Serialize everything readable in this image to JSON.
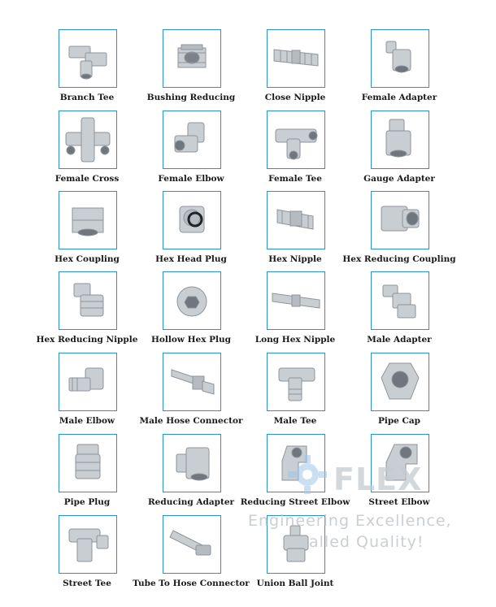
{
  "items": [
    {
      "label": "Branch Tee",
      "icon": "branch-tee-fitting"
    },
    {
      "label": "Bushing Reducing",
      "icon": "bushing-reducing-fitting"
    },
    {
      "label": "Close Nipple",
      "icon": "close-nipple-fitting"
    },
    {
      "label": "Female Adapter",
      "icon": "female-adapter-fitting"
    },
    {
      "label": "Female Cross",
      "icon": "female-cross-fitting"
    },
    {
      "label": "Female Elbow",
      "icon": "female-elbow-fitting"
    },
    {
      "label": "Female Tee",
      "icon": "female-tee-fitting"
    },
    {
      "label": "Gauge Adapter",
      "icon": "gauge-adapter-fitting"
    },
    {
      "label": "Hex Coupling",
      "icon": "hex-coupling-fitting"
    },
    {
      "label": "Hex Head Plug",
      "icon": "hex-head-plug-fitting"
    },
    {
      "label": "Hex Nipple",
      "icon": "hex-nipple-fitting"
    },
    {
      "label": "Hex Reducing Coupling",
      "icon": "hex-reducing-coupling-fitting"
    },
    {
      "label": "Hex Reducing Nipple",
      "icon": "hex-reducing-nipple-fitting"
    },
    {
      "label": "Hollow Hex Plug",
      "icon": "hollow-hex-plug-fitting"
    },
    {
      "label": "Long Hex Nipple",
      "icon": "long-hex-nipple-fitting"
    },
    {
      "label": "Male Adapter",
      "icon": "male-adapter-fitting"
    },
    {
      "label": "Male Elbow",
      "icon": "male-elbow-fitting"
    },
    {
      "label": "Male Hose Connector",
      "icon": "male-hose-connector-fitting"
    },
    {
      "label": "Male Tee",
      "icon": "male-tee-fitting"
    },
    {
      "label": "Pipe Cap",
      "icon": "pipe-cap-fitting"
    },
    {
      "label": "Pipe Plug",
      "icon": "pipe-plug-fitting"
    },
    {
      "label": "Reducing Adapter",
      "icon": "reducing-adapter-fitting"
    },
    {
      "label": "Reducing Street Elbow",
      "icon": "reducing-street-elbow-fitting"
    },
    {
      "label": "Street Elbow",
      "icon": "street-elbow-fitting"
    },
    {
      "label": "Street Tee",
      "icon": "street-tee-fitting"
    },
    {
      "label": "Tube To Hose Connector",
      "icon": "tube-to-hose-connector-fitting"
    },
    {
      "label": "Union Ball Joint",
      "icon": "union-ball-joint-fitting"
    }
  ],
  "watermark": {
    "logo": "FLEX",
    "line1": "Engineering Excellence,",
    "line2": "alled Quality!"
  },
  "colors": {
    "border": "#2b8fd0",
    "metal": "#c9ced3",
    "metal_dark": "#8d949b"
  }
}
